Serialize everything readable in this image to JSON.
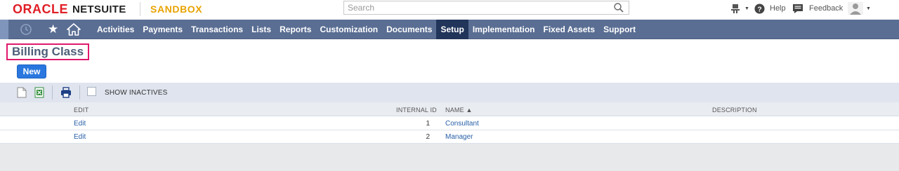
{
  "header": {
    "logo_oracle": "ORACLE",
    "logo_netsuite": "NETSUITE",
    "environment": "SANDBOX",
    "search_placeholder": "Search",
    "help_label": "Help",
    "feedback_label": "Feedback"
  },
  "nav": {
    "items": [
      {
        "label": "Activities",
        "active": false
      },
      {
        "label": "Payments",
        "active": false
      },
      {
        "label": "Transactions",
        "active": false
      },
      {
        "label": "Lists",
        "active": false
      },
      {
        "label": "Reports",
        "active": false
      },
      {
        "label": "Customization",
        "active": false
      },
      {
        "label": "Documents",
        "active": false
      },
      {
        "label": "Setup",
        "active": true
      },
      {
        "label": "Implementation",
        "active": false
      },
      {
        "label": "Fixed Assets",
        "active": false
      },
      {
        "label": "Support",
        "active": false
      }
    ]
  },
  "page": {
    "title": "Billing Class",
    "new_button": "New"
  },
  "toolbar": {
    "show_inactives_label": "SHOW INACTIVES",
    "show_inactives_checked": false
  },
  "table": {
    "columns": {
      "edit": "EDIT",
      "internal_id": "INTERNAL ID",
      "name": "NAME ▲",
      "description": "DESCRIPTION"
    },
    "rows": [
      {
        "edit": "Edit",
        "internal_id": "1",
        "name": "Consultant",
        "description": ""
      },
      {
        "edit": "Edit",
        "internal_id": "2",
        "name": "Manager",
        "description": ""
      }
    ]
  },
  "colors": {
    "brand_red": "#e01f26",
    "sandbox_orange": "#e8a300",
    "nav_bg": "#5a6e93",
    "nav_active": "#213459",
    "title_highlight": "#e0196d",
    "new_button": "#2a77df",
    "link": "#275fa7"
  }
}
